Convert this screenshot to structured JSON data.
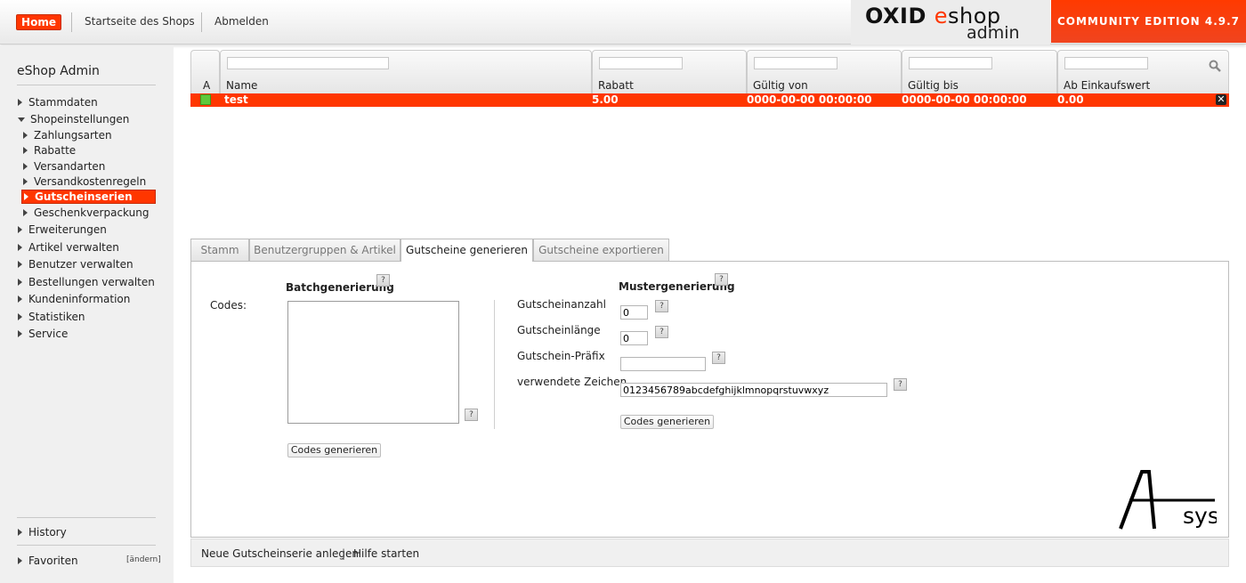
{
  "header": {
    "home_label": "Home",
    "shop_start_label": "Startseite des Shops",
    "logout_label": "Abmelden",
    "logo_word1": "OXID",
    "logo_word2_e": "e",
    "logo_word2_rest": "shop",
    "logo_sub": "admin",
    "edition": "COMMUNITY EDITION 4.9.7"
  },
  "sidebar": {
    "title": "eShop Admin",
    "items": [
      {
        "label": "Stammdaten"
      },
      {
        "label": "Shopeinstellungen"
      },
      {
        "label": "Zahlungsarten"
      },
      {
        "label": "Rabatte"
      },
      {
        "label": "Versandarten"
      },
      {
        "label": "Versandkostenregeln"
      },
      {
        "label": "Gutscheinserien"
      },
      {
        "label": "Geschenkverpackung"
      },
      {
        "label": "Erweiterungen"
      },
      {
        "label": "Artikel verwalten"
      },
      {
        "label": "Benutzer verwalten"
      },
      {
        "label": "Bestellungen verwalten"
      },
      {
        "label": "Kundeninformation"
      },
      {
        "label": "Statistiken"
      },
      {
        "label": "Service"
      }
    ],
    "history_label": "History",
    "favorites_label": "Favoriten",
    "favorites_edit": "[ändern]"
  },
  "list": {
    "columns": {
      "active": "A",
      "name": "Name",
      "discount": "Rabatt",
      "valid_from": "Gültig von",
      "valid_to": "Gültig bis",
      "min_order": "Ab Einkaufswert"
    },
    "rows": [
      {
        "name": "test",
        "discount": "5.00",
        "valid_from": "0000-00-00 00:00:00",
        "valid_to": "0000-00-00 00:00:00",
        "min_order": "0.00"
      }
    ]
  },
  "tabs": [
    {
      "label": "Stamm"
    },
    {
      "label": "Benutzergruppen & Artikel"
    },
    {
      "label": "Gutscheine generieren"
    },
    {
      "label": "Gutscheine exportieren"
    }
  ],
  "batch": {
    "heading": "Batchgenerierung",
    "codes_label": "Codes:",
    "codes_value": "",
    "generate_label": "Codes generieren"
  },
  "pattern": {
    "heading": "Mustergenerierung",
    "count_label": "Gutscheinanzahl",
    "count_value": "0",
    "length_label": "Gutscheinlänge",
    "length_value": "0",
    "prefix_label": "Gutschein-Präfix",
    "prefix_value": "",
    "chars_label": "verwendete Zeichen",
    "chars_value": "0123456789abcdefghijklmnopqrstuvwxyz",
    "generate_label": "Codes generieren"
  },
  "help_icon_text": "?",
  "asys_logo_text": "sys",
  "footer": {
    "new_series": "Neue Gutscheinserie anlegen",
    "separator": "|",
    "help": "Hilfe starten"
  }
}
